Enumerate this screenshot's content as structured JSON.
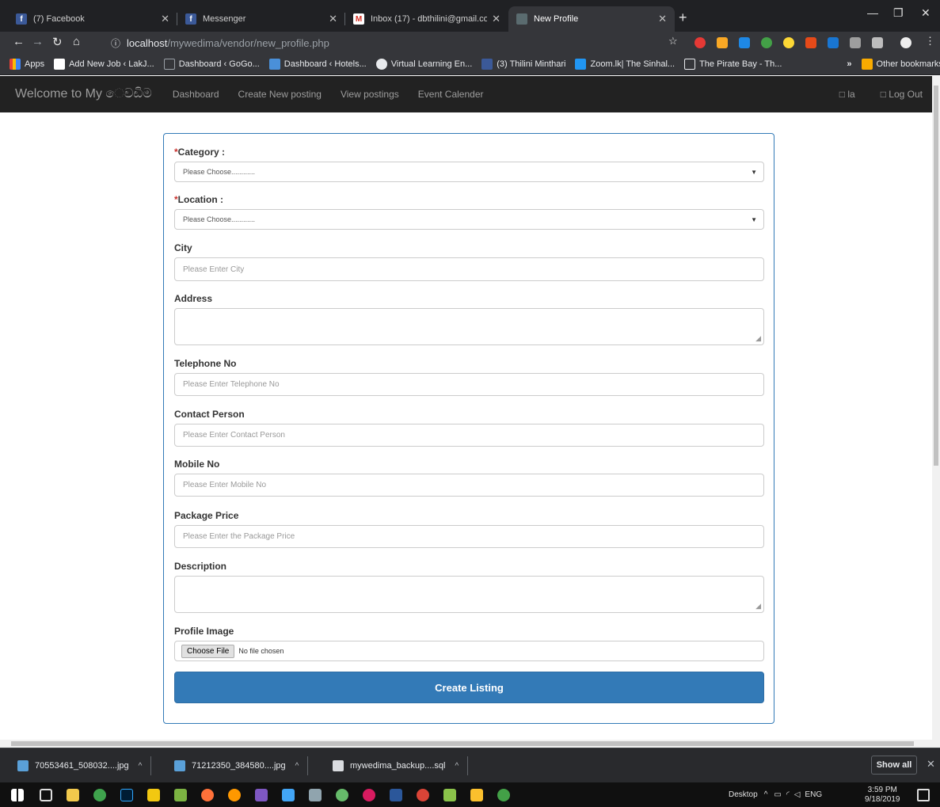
{
  "browser": {
    "tabs": [
      {
        "title": "(7) Facebook",
        "icon": "facebook-icon"
      },
      {
        "title": "Messenger",
        "icon": "facebook-icon"
      },
      {
        "title": "Inbox (17) - dbthilini@gmail.com",
        "icon": "gmail-icon"
      },
      {
        "title": "New Profile",
        "icon": "page-icon"
      }
    ],
    "url_host": "localhost",
    "url_path": "/mywedima/vendor/new_profile.php",
    "bookmarks": [
      "Apps",
      "Add New Job ‹ LakJ...",
      "Dashboard ‹ GoGo...",
      "Dashboard ‹ Hotels...",
      "Virtual Learning En...",
      "(3) Thilini Minthari",
      "Zoom.lk| The Sinhal...",
      "The Pirate Bay - Th..."
    ],
    "bookmarks_more": "»",
    "other_bookmarks": "Other bookmarks"
  },
  "navbar": {
    "brand": "Welcome to My ෙවඩිම",
    "links": [
      "Dashboard",
      "Create New posting",
      "View postings",
      "Event Calender"
    ],
    "right": [
      "□ la",
      "□ Log Out"
    ]
  },
  "form": {
    "category": {
      "label": "Category :",
      "required_mark": "*",
      "value": "Please Choose............"
    },
    "location": {
      "label": "Location :",
      "required_mark": "*",
      "value": "Please Choose............"
    },
    "city": {
      "label": "City",
      "placeholder": "Please Enter City"
    },
    "address": {
      "label": "Address"
    },
    "telephone": {
      "label": "Telephone No",
      "placeholder": "Please Enter Telephone No"
    },
    "contact": {
      "label": "Contact Person",
      "placeholder": "Please Enter Contact Person"
    },
    "mobile": {
      "label": "Mobile No",
      "placeholder": "Please Enter Mobile No"
    },
    "price": {
      "label": "Package Price",
      "placeholder": "Please Enter the Package Price"
    },
    "description": {
      "label": "Description"
    },
    "image": {
      "label": "Profile Image",
      "button": "Choose File",
      "status": "No file chosen"
    },
    "submit": "Create Listing"
  },
  "downloads": {
    "items": [
      "70553461_508032....jpg",
      "71212350_384580....jpg",
      "mywedima_backup....sql"
    ],
    "show_all": "Show all"
  },
  "taskbar": {
    "desktop": "Desktop",
    "lang": "ENG",
    "time": "3:59 PM",
    "date": "9/18/2019"
  },
  "colors": {
    "primary": "#337ab7",
    "navbar": "#222222",
    "required": "#c9302c"
  }
}
